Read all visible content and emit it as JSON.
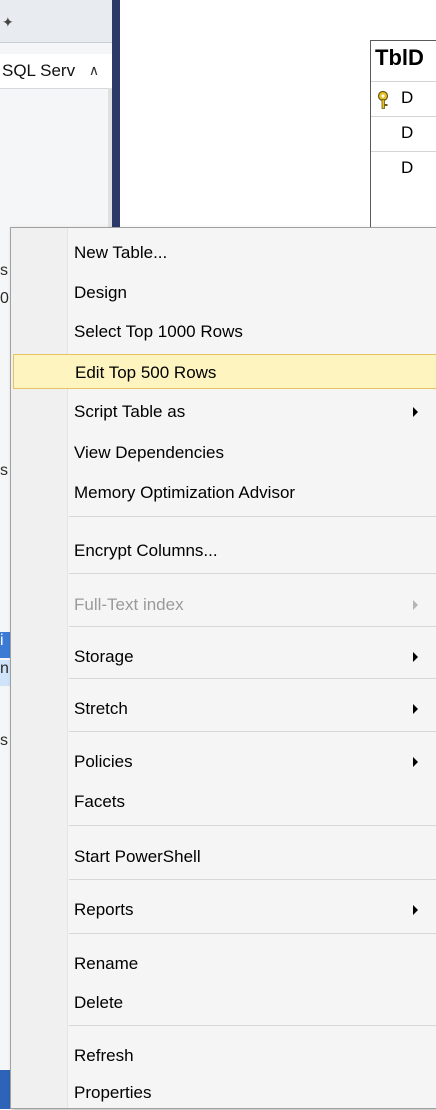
{
  "explorer": {
    "server_label": "SQL Serv",
    "fragments": [
      "s",
      "0",
      "s",
      "i",
      "n",
      "s"
    ]
  },
  "diagram": {
    "title": "TblD",
    "rows": [
      "D",
      "D",
      "D"
    ]
  },
  "context_menu": {
    "items": [
      {
        "label": "New Table..."
      },
      {
        "label": "Design"
      },
      {
        "label": "Select Top 1000 Rows"
      },
      {
        "label": "Edit Top 500 Rows",
        "highlighted": true
      },
      {
        "label": "Script Table as",
        "submenu": true
      },
      {
        "label": "View Dependencies"
      },
      {
        "label": "Memory Optimization Advisor"
      },
      {
        "label": "Encrypt Columns..."
      },
      {
        "label": "Full-Text index",
        "submenu": true,
        "disabled": true
      },
      {
        "label": "Storage",
        "submenu": true
      },
      {
        "label": "Stretch",
        "submenu": true
      },
      {
        "label": "Policies",
        "submenu": true
      },
      {
        "label": "Facets"
      },
      {
        "label": "Start PowerShell"
      },
      {
        "label": "Reports",
        "submenu": true
      },
      {
        "label": "Rename"
      },
      {
        "label": "Delete"
      },
      {
        "label": "Refresh"
      },
      {
        "label": "Properties"
      }
    ]
  },
  "colors": {
    "highlight_bg": "#fdf4bf",
    "highlight_border": "#e5c365",
    "splitter": "#2b3a67",
    "tree_selection": "#3c7bd4"
  },
  "icons": [
    "pin-icon",
    "scroll-up-arrow-icon",
    "primary-key-icon",
    "submenu-arrow-icon"
  ]
}
